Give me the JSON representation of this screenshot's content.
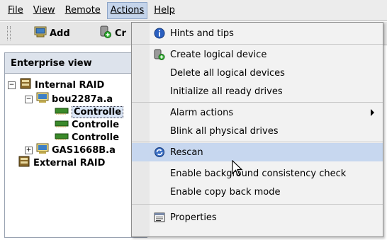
{
  "menubar": {
    "items": [
      {
        "label": "File"
      },
      {
        "label": "View"
      },
      {
        "label": "Remote"
      },
      {
        "label": "Actions"
      },
      {
        "label": "Help"
      }
    ]
  },
  "toolbar": {
    "add_label": "Add",
    "create_label": "Cr"
  },
  "left_panel": {
    "tab_label": "Enterprise view",
    "tree": [
      {
        "label": "Internal RAID",
        "expander": "−"
      },
      {
        "label": "bou2287a.a",
        "expander": "−"
      },
      {
        "label": "Controlle"
      },
      {
        "label": "Controlle"
      },
      {
        "label": "Controlle"
      },
      {
        "label": "GAS1668B.a",
        "expander": "+"
      },
      {
        "label": "External RAID"
      }
    ]
  },
  "actions_menu": {
    "items": [
      {
        "label": "Hints and tips",
        "icon": "info-icon"
      },
      {
        "label": "Create logical device",
        "icon": "create-device-icon"
      },
      {
        "label": "Delete all logical devices"
      },
      {
        "label": "Initialize all ready drives"
      },
      {
        "label": "Alarm actions",
        "submenu": true
      },
      {
        "label": "Blink all physical drives"
      },
      {
        "label": "Rescan",
        "icon": "rescan-icon",
        "highlighted": true
      },
      {
        "label": "Enable background consistency check"
      },
      {
        "label": "Enable copy back mode"
      },
      {
        "label": "Properties",
        "icon": "properties-icon"
      }
    ]
  },
  "colors": {
    "menu_highlight": "#c7d7ef",
    "panel_border": "#9aa3b2"
  }
}
